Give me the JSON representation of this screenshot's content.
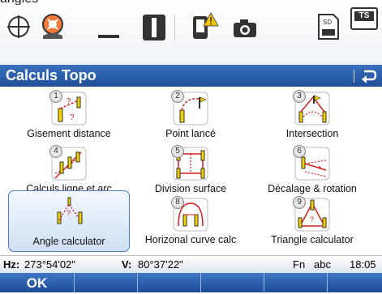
{
  "window": {
    "partial_title": "angles"
  },
  "toolbar": {
    "icons": [
      "target-icon",
      "satellite-icon",
      "minimize-bar-icon",
      "instrument-icon",
      "warning-device-icon",
      "camera-icon",
      "sd-card-icon",
      "ts-battery-icon"
    ],
    "ts_label": "TS",
    "sd_label": "SD"
  },
  "titlebar": {
    "title": "Calculs Topo"
  },
  "apps": [
    {
      "number": "1",
      "label": "Gisement distance"
    },
    {
      "number": "2",
      "label": "Point lancé"
    },
    {
      "number": "3",
      "label": "Intersection"
    },
    {
      "number": "4",
      "label": "Calculs ligne et arc"
    },
    {
      "number": "5",
      "label": "Division surface"
    },
    {
      "number": "6",
      "label": "Décalage & rotation"
    },
    {
      "number": "",
      "label": "Angle calculator"
    },
    {
      "number": "8",
      "label": "Horizonal curve calc"
    },
    {
      "number": "9",
      "label": "Triangle calculator"
    }
  ],
  "selected_app": "Angle calculator",
  "measurement": {
    "hz_label": "Hz:",
    "hz_value": "273°54'02\"",
    "v_label": "V:",
    "v_value": "80°37'22\"",
    "fn_label": "Fn",
    "input_mode": "abc",
    "time": "18:05"
  },
  "softkeys": {
    "ok": "OK"
  },
  "colors": {
    "title_bar": "#2a5fae",
    "selection_border": "#4a80c2",
    "accent_red": "#d42020",
    "accent_yellow": "#f0d020"
  }
}
